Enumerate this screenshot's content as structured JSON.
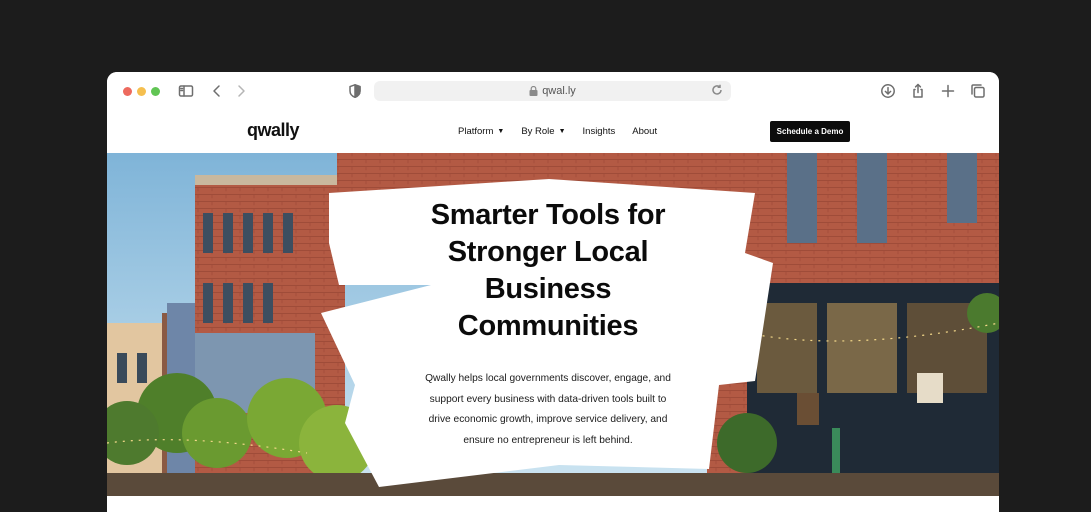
{
  "browser": {
    "url": "qwal.ly",
    "icons": [
      "sidebar-icon",
      "back-icon",
      "forward-icon",
      "shield-icon",
      "lock-icon",
      "reload-icon",
      "download-icon",
      "share-icon",
      "new-tab-icon",
      "tabs-overview-icon"
    ]
  },
  "site": {
    "logo": "qwally",
    "nav": {
      "platform": "Platform",
      "by_role": "By Role",
      "insights": "Insights",
      "about": "About",
      "demo_button": "Schedule a Demo"
    },
    "hero": {
      "headline_lines": [
        "Smarter Tools for",
        "Stronger Local",
        "Business",
        "Communities"
      ],
      "subtext_lines": [
        "Qwally helps local governments discover, engage, and",
        "support every business with data-driven tools built to",
        "drive economic growth, improve service delivery, and",
        "ensure no entrepreneur is left behind."
      ]
    }
  },
  "colors": {
    "page_background": "#1c1c1c",
    "brick": "#b8553f",
    "sky": "#a9cde4",
    "button": "#0c0c0c"
  }
}
